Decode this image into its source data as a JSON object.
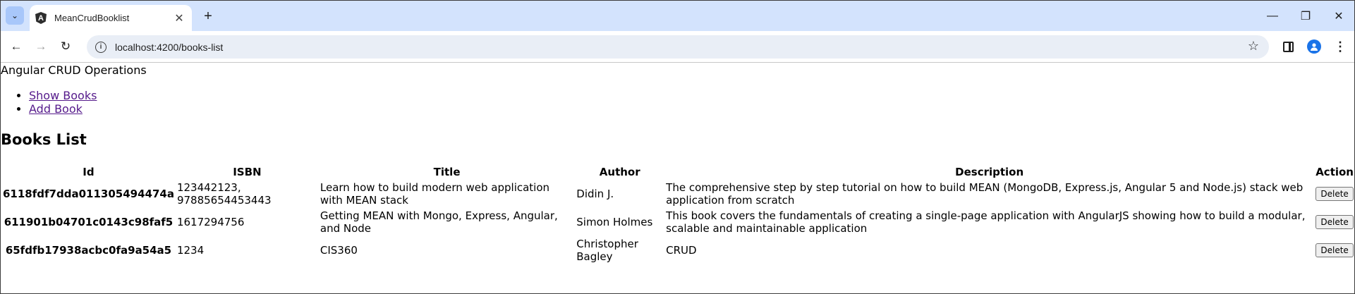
{
  "browser": {
    "tab_title": "MeanCrudBooklist",
    "tab_favicon": "angular-logo-icon",
    "url": "localhost:4200/books-list",
    "controls": {
      "back": "arrow-left-icon",
      "forward": "arrow-right-icon",
      "reload": "reload-icon",
      "minimize": "minimize-icon",
      "restore": "restore-icon",
      "close": "close-icon"
    }
  },
  "page": {
    "app_title": "Angular CRUD Operations",
    "nav": [
      {
        "label": "Show Books"
      },
      {
        "label": "Add Book"
      }
    ],
    "heading": "Books List",
    "table": {
      "headers": [
        "Id",
        "ISBN",
        "Title",
        "Author",
        "Description",
        "Action"
      ],
      "rows": [
        {
          "id": "6118fdf7dda011305494474a",
          "isbn": "123442123, 97885654453443",
          "title": "Learn how to build modern web application with MEAN stack",
          "author": "Didin J.",
          "description": "The comprehensive step by step tutorial on how to build MEAN (MongoDB, Express.js, Angular 5 and Node.js) stack web application from scratch",
          "action": "Delete"
        },
        {
          "id": "611901b04701c0143c98faf5",
          "isbn": "1617294756",
          "title": "Getting MEAN with Mongo, Express, Angular, and Node",
          "author": "Simon Holmes",
          "description": "This book covers the fundamentals of creating a single-page application with AngularJS showing how to build a modular, scalable and maintainable application",
          "action": "Delete"
        },
        {
          "id": "65fdfb17938acbc0fa9a54a5",
          "isbn": "1234",
          "title": "CIS360",
          "author": "Christopher Bagley",
          "description": "CRUD",
          "action": "Delete"
        }
      ]
    }
  },
  "colors": {
    "tabstrip": "#d3e3fd",
    "omnibox": "#e9eef6",
    "visited_link": "#551a8b",
    "profile": "#1a73e8"
  }
}
